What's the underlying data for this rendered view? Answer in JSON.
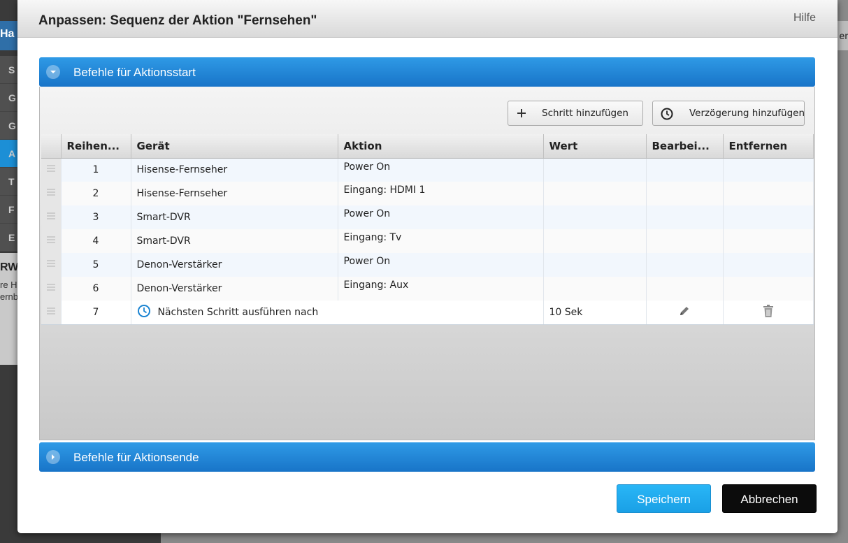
{
  "background": {
    "header_fragment": "Ha",
    "nav_items": [
      "S",
      "G",
      "G",
      "A",
      "T",
      "F",
      "E"
    ],
    "info_title_fragment": "RW",
    "info_line1_fragment": "re H",
    "info_line2_fragment": "ernb",
    "right_band_fragment": "er"
  },
  "dialog": {
    "title": "Anpassen: Sequenz der Aktion \"Fernsehen\"",
    "help_label": "Hilfe"
  },
  "section_start": {
    "label": "Befehle für Aktionsstart",
    "add_step_label": "Schritt hinzufügen",
    "add_delay_label": "Verzögerung hinzufügen"
  },
  "table": {
    "columns": [
      "Reihen...",
      "Gerät",
      "Aktion",
      "Wert",
      "Bearbei...",
      "Entfernen"
    ],
    "rows": [
      {
        "order": "1",
        "device": "Hisense-Fernseher",
        "action": "Power On",
        "value": ""
      },
      {
        "order": "2",
        "device": "Hisense-Fernseher",
        "action": "Eingang: HDMI 1",
        "value": ""
      },
      {
        "order": "3",
        "device": "Smart-DVR",
        "action": "Power On",
        "value": ""
      },
      {
        "order": "4",
        "device": "Smart-DVR",
        "action": "Eingang: Tv",
        "value": ""
      },
      {
        "order": "5",
        "device": "Denon-Verstärker",
        "action": "Power On",
        "value": ""
      },
      {
        "order": "6",
        "device": "Denon-Verstärker",
        "action": "Eingang: Aux",
        "value": ""
      }
    ],
    "delay_row": {
      "order": "7",
      "text": "Nächsten Schritt ausführen nach",
      "value": "10 Sek"
    }
  },
  "section_end": {
    "label": "Befehle für Aktionsende"
  },
  "footer": {
    "save_label": "Speichern",
    "cancel_label": "Abbrechen"
  },
  "colors": {
    "accent_blue": "#1874c8",
    "save_button": "#1aa0e6",
    "cancel_button": "#0c0c0c"
  },
  "icons": [
    "chevron-down-icon",
    "plus-icon",
    "clock-icon",
    "drag-handle-icon",
    "pencil-icon",
    "trash-icon",
    "chevron-right-icon"
  ]
}
